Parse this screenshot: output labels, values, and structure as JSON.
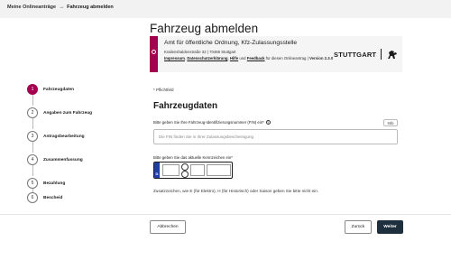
{
  "breadcrumb": {
    "home": "Meine Onlineanträge",
    "separator": "→",
    "current": "Fahrzeug abmelden"
  },
  "page_title": "Fahrzeug abmelden",
  "authority": {
    "name": "Amt für öffentliche Ordnung, Kfz-Zulassungsstelle",
    "address": "Krailenshaldenstraße 32 | 70469 Stuttgart",
    "link_impressum": "Impressum",
    "comma1": ", ",
    "link_datenschutz": "Datenschutzerklärung",
    "comma2": ", ",
    "link_hilfe": "Hilfe",
    "und": " und ",
    "link_feedback": "Feedback",
    "suffix": " für diesen Onlineantrag | ",
    "version": "Version 2.3.0",
    "logo_text": "STUTTGART",
    "accent_color": "#a3004f"
  },
  "steps": [
    {
      "number": "1",
      "label": "Fahrzeugdaten",
      "active": true
    },
    {
      "number": "2",
      "label": "Angaben zum Fahrzeug",
      "active": false
    },
    {
      "number": "3",
      "label": "Antragsbearbeitung",
      "active": false
    },
    {
      "number": "4",
      "label": "Zusammenfassung",
      "active": false
    },
    {
      "number": "5",
      "label": "Bezahlung",
      "active": false
    },
    {
      "number": "6",
      "label": "Bescheid",
      "active": false
    }
  ],
  "form": {
    "required_note": "* Pflichtfeld",
    "section_title": "Fahrzeugdaten",
    "fin_label": "Bitte geben Sie Ihre Fahrzeug-Identifizierungsnummer (FIN) ein*",
    "help_icon_glyph": "?",
    "info_button": "Info",
    "fin_placeholder": "Die FIN finden Sie in Ihrer Zulassungsbescheinigung",
    "fin_value": "",
    "plate_label": "Bitte geben Sie das aktuelle Kennzeichen ein*",
    "plate_country": "D",
    "plate_note": "Zusatzzeichen, wie E (für Elektro), H (für Historisch) oder Saison geben Sie bitte nicht ein."
  },
  "buttons": {
    "cancel": "Abbrechen",
    "back": "Zurück",
    "next": "Weiter"
  }
}
